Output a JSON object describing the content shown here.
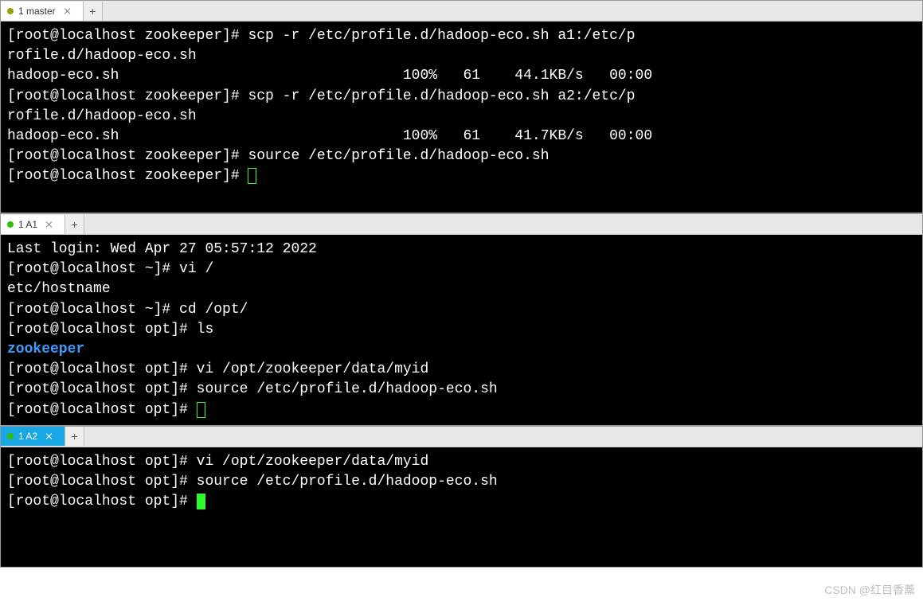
{
  "watermark": "CSDN @红目香薰",
  "panes": {
    "master": {
      "tab": {
        "label": "1 master",
        "dot_color": "#9aa000"
      },
      "lines": [
        {
          "segments": [
            {
              "text": "[root@localhost zookeeper]# "
            },
            {
              "text": "scp -r /etc/profile.d/hadoop-eco.sh a1:/etc/p"
            }
          ]
        },
        {
          "segments": [
            {
              "text": "rofile.d/hadoop-eco.sh"
            }
          ]
        },
        {
          "segments": [
            {
              "text": "hadoop-eco.sh                                 100%   61    44.1KB/s   00:00"
            }
          ]
        },
        {
          "segments": [
            {
              "text": "[root@localhost zookeeper]# "
            },
            {
              "text": "scp -r /etc/profile.d/hadoop-eco.sh a2:/etc/p"
            }
          ]
        },
        {
          "segments": [
            {
              "text": "rofile.d/hadoop-eco.sh"
            }
          ]
        },
        {
          "segments": [
            {
              "text": "hadoop-eco.sh                                 100%   61    41.7KB/s   00:00"
            }
          ]
        },
        {
          "segments": [
            {
              "text": "[root@localhost zookeeper]# "
            },
            {
              "text": "source /etc/profile.d/hadoop-eco.sh"
            }
          ]
        },
        {
          "segments": [
            {
              "text": "[root@localhost zookeeper]# "
            },
            {
              "cursor": "outline"
            }
          ]
        }
      ]
    },
    "a1": {
      "tab": {
        "label": "1 A1",
        "dot_color": "#2dc100"
      },
      "lines": [
        {
          "segments": [
            {
              "text": "Last login: Wed Apr 27 05:57:12 2022"
            }
          ]
        },
        {
          "segments": [
            {
              "text": "[root@localhost ~]# "
            },
            {
              "text": "vi /"
            }
          ]
        },
        {
          "segments": [
            {
              "text": "etc/hostname"
            }
          ]
        },
        {
          "segments": [
            {
              "text": "[root@localhost ~]# "
            },
            {
              "text": "cd /opt/"
            }
          ]
        },
        {
          "segments": [
            {
              "text": "[root@localhost opt]# "
            },
            {
              "text": "ls"
            }
          ]
        },
        {
          "segments": [
            {
              "text": "zookeeper",
              "class": "blue"
            }
          ]
        },
        {
          "segments": [
            {
              "text": "[root@localhost opt]# "
            },
            {
              "text": "vi /opt/zookeeper/data/myid"
            }
          ]
        },
        {
          "segments": [
            {
              "text": "[root@localhost opt]# "
            },
            {
              "text": "source /etc/profile.d/hadoop-eco.sh"
            }
          ]
        },
        {
          "segments": [
            {
              "text": "[root@localhost opt]# "
            },
            {
              "cursor": "outline"
            }
          ]
        }
      ]
    },
    "a2": {
      "tab": {
        "label": "1 A2",
        "dot_color": "#2dc100"
      },
      "lines": [
        {
          "segments": [
            {
              "text": "[root@localhost opt]# "
            },
            {
              "text": "vi /opt/zookeeper/data/myid"
            }
          ]
        },
        {
          "segments": [
            {
              "text": "[root@localhost opt]# "
            },
            {
              "text": "source /etc/profile.d/hadoop-eco.sh"
            }
          ]
        },
        {
          "segments": [
            {
              "text": "[root@localhost opt]# "
            },
            {
              "cursor": "solid"
            }
          ]
        }
      ]
    }
  }
}
